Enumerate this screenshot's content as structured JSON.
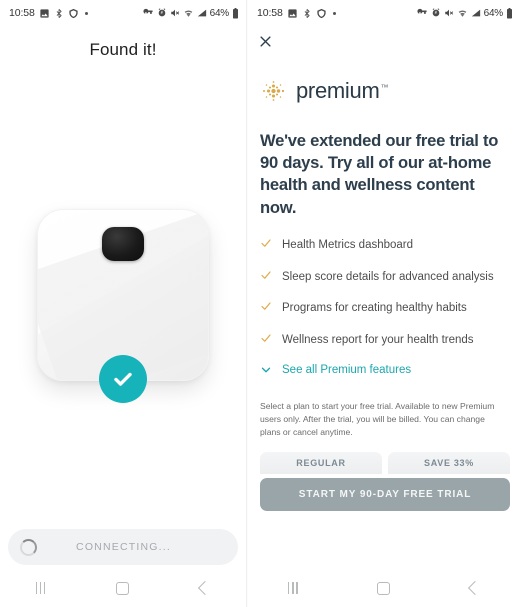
{
  "status_bar": {
    "time": "10:58",
    "battery_text": "64%",
    "left_icons": [
      "image-icon",
      "bluetooth-transfer-icon",
      "shield-icon",
      "dot-icon"
    ],
    "right_icons": [
      "vpn-key-icon",
      "alarm-icon",
      "mute-icon",
      "wifi-icon",
      "signal-icon",
      "battery-icon"
    ]
  },
  "left_screen": {
    "title": "Found it!",
    "device": {
      "name": "smart-scale",
      "badge_icon": "check-circle-icon",
      "badge_color": "#16b3bb"
    },
    "connect_bar": {
      "spinner_icon": "loading-spinner-icon",
      "label": "CONNECTING..."
    }
  },
  "right_screen": {
    "close_icon": "close-icon",
    "brand": {
      "logo_icon": "premium-dots-logo-icon",
      "name": "premium",
      "trademark": "™",
      "logo_color": "#d9a94a",
      "text_color": "#2a3b47"
    },
    "headline": "We've extended our free trial to 90 days. Try all of our at-home health and wellness content now.",
    "features": [
      {
        "icon": "check-icon",
        "label": "Health Metrics dashboard"
      },
      {
        "icon": "check-icon",
        "label": "Sleep score details for advanced analysis"
      },
      {
        "icon": "check-icon",
        "label": "Programs for creating healthy habits"
      },
      {
        "icon": "check-icon",
        "label": "Wellness report for your health trends"
      }
    ],
    "see_all": {
      "icon": "chevron-down-icon",
      "label": "See all Premium features",
      "color": "#1aa7ad"
    },
    "fine_print": "Select a plan to start your free trial. Available to new Premium users only. After the trial, you will be billed. You can change plans or cancel anytime.",
    "plan_tabs": [
      {
        "label": "REGULAR"
      },
      {
        "label": "SAVE 33%"
      }
    ],
    "cta_label": "START MY 90-DAY FREE TRIAL",
    "cta_color": "#9aa5a9"
  },
  "nav_bar": {
    "recents_icon": "recents-icon",
    "home_icon": "home-icon",
    "back_icon": "back-icon"
  }
}
